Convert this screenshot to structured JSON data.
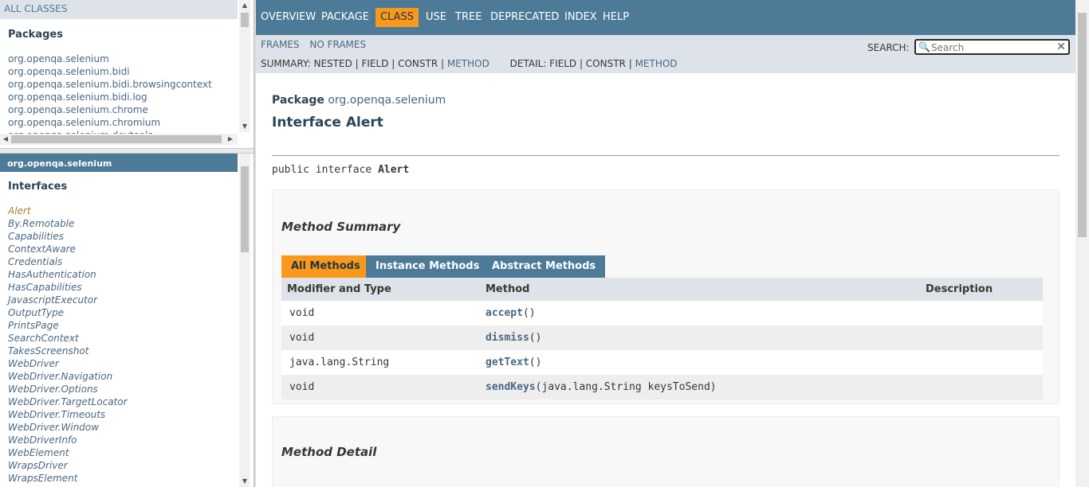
{
  "left": {
    "all_classes": "ALL CLASSES",
    "packages_heading": "Packages",
    "packages": [
      "org.openqa.selenium",
      "org.openqa.selenium.bidi",
      "org.openqa.selenium.bidi.browsingcontext",
      "org.openqa.selenium.bidi.log",
      "org.openqa.selenium.chrome",
      "org.openqa.selenium.chromium",
      "org.openqa.selenium.devtools"
    ],
    "current_package": "org.openqa.selenium",
    "interfaces_heading": "Interfaces",
    "interfaces": [
      "Alert",
      "By.Remotable",
      "Capabilities",
      "ContextAware",
      "Credentials",
      "HasAuthentication",
      "HasCapabilities",
      "JavascriptExecutor",
      "OutputType",
      "PrintsPage",
      "SearchContext",
      "TakesScreenshot",
      "WebDriver",
      "WebDriver.Navigation",
      "WebDriver.Options",
      "WebDriver.TargetLocator",
      "WebDriver.Timeouts",
      "WebDriver.Window",
      "WebDriverInfo",
      "WebElement",
      "WrapsDriver",
      "WrapsElement"
    ]
  },
  "topnav": {
    "overview": "OVERVIEW",
    "package": "PACKAGE",
    "class": "CLASS",
    "use": "USE",
    "tree": "TREE",
    "deprecated": "DEPRECATED",
    "index": "INDEX",
    "help": "HELP"
  },
  "subnav": {
    "frames": "FRAMES",
    "no_frames": "NO FRAMES",
    "summary_prefix": "SUMMARY: NESTED | FIELD | CONSTR | ",
    "summary_method": "METHOD",
    "detail_prefix": "DETAIL: FIELD | CONSTR | ",
    "detail_method": "METHOD",
    "search_label": "SEARCH:",
    "search_placeholder": "Search"
  },
  "header": {
    "package_label": "Package",
    "package_name": "org.openqa.selenium",
    "title": "Interface Alert",
    "signature_prefix": "public interface ",
    "signature_name": "Alert"
  },
  "method_summary": {
    "title": "Method Summary",
    "tabs": [
      "All Methods",
      "Instance Methods",
      "Abstract Methods"
    ],
    "columns": [
      "Modifier and Type",
      "Method",
      "Description"
    ],
    "rows": [
      {
        "type": "void",
        "method": "accept",
        "params": "()",
        "description": ""
      },
      {
        "type": "void",
        "method": "dismiss",
        "params": "()",
        "description": ""
      },
      {
        "type": "java.lang.String",
        "method": "getText",
        "params": "()",
        "description": ""
      },
      {
        "type": "void",
        "method": "sendKeys",
        "params": "(java.lang.String keysToSend)",
        "description": ""
      }
    ]
  },
  "method_detail": {
    "title": "Method Detail"
  }
}
